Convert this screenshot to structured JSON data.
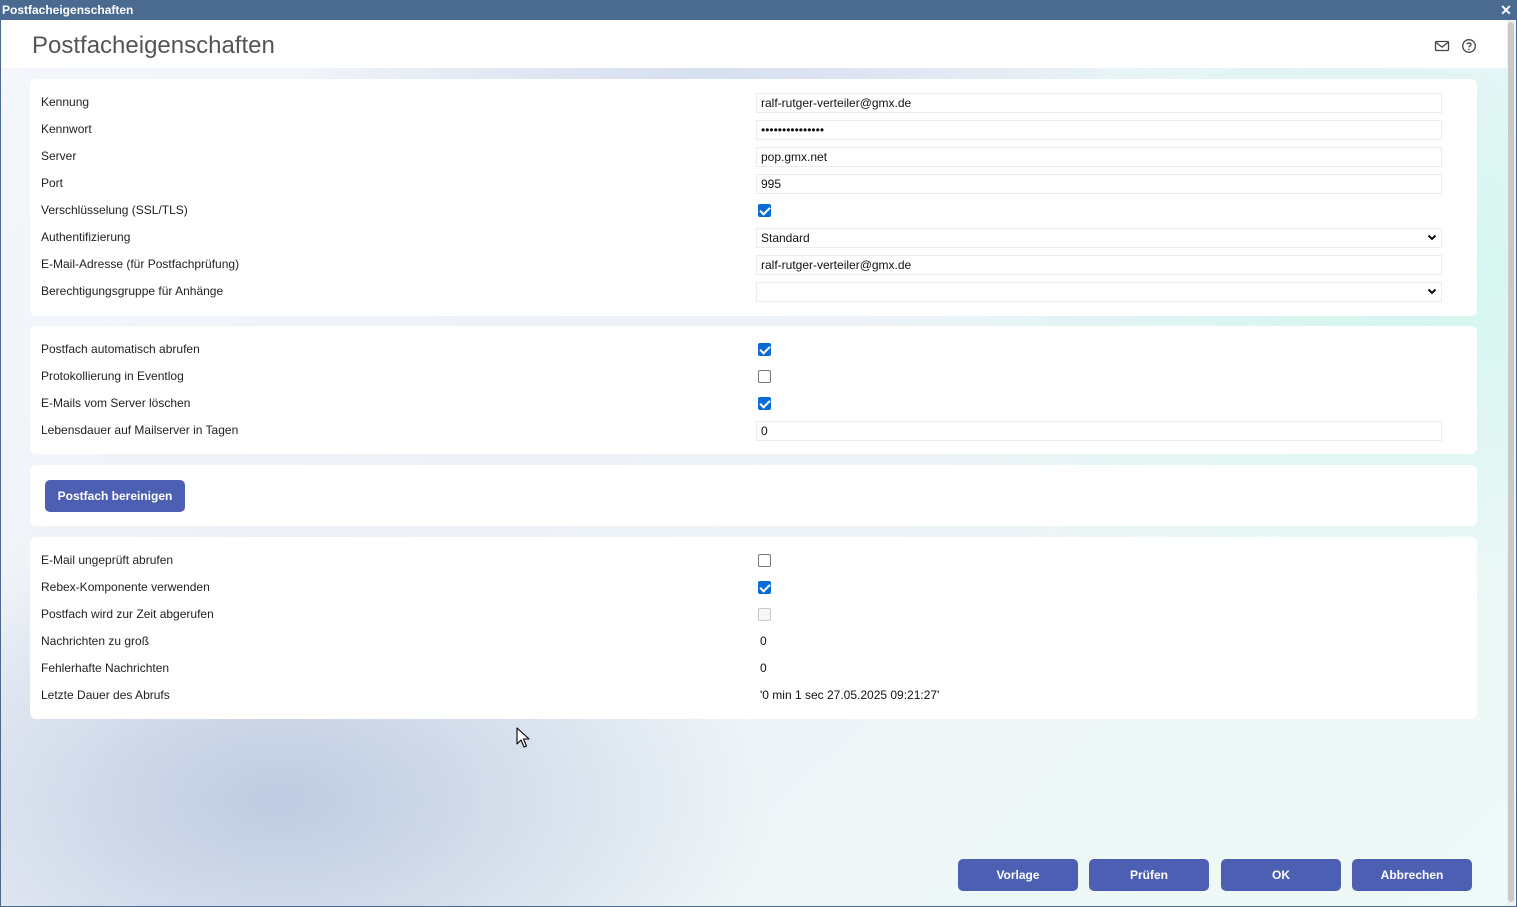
{
  "window": {
    "title": "Postfacheigenschaften",
    "close_glyph": "✕"
  },
  "header": {
    "title": "Postfacheigenschaften",
    "icons": [
      "mail-icon",
      "help-icon"
    ]
  },
  "connection": {
    "kennung_label": "Kennung",
    "kennung_value": "ralf-rutger-verteiler@gmx.de",
    "kennwort_label": "Kennwort",
    "kennwort_value": "•••••••••••••••",
    "server_label": "Server",
    "server_value": "pop.gmx.net",
    "port_label": "Port",
    "port_value": "995",
    "ssl_label": "Verschlüsselung (SSL/TLS)",
    "ssl_checked": true,
    "auth_label": "Authentifizierung",
    "auth_value": "Standard",
    "email_label": "E-Mail-Adresse (für Postfachprüfung)",
    "email_value": "ralf-rutger-verteiler@gmx.de",
    "group_label": "Berechtigungsgruppe für Anhänge",
    "group_value": ""
  },
  "retrieval": {
    "auto_label": "Postfach automatisch abrufen",
    "auto_checked": true,
    "log_label": "Protokollierung in Eventlog",
    "log_checked": false,
    "delete_label": "E-Mails vom Server löschen",
    "delete_checked": true,
    "lifetime_label": "Lebensdauer auf Mailserver in Tagen",
    "lifetime_value": "0"
  },
  "cleanup": {
    "button_label": "Postfach bereinigen"
  },
  "status": {
    "unchecked_label": "E-Mail ungeprüft abrufen",
    "unchecked_checked": false,
    "rebex_label": "Rebex-Komponente verwenden",
    "rebex_checked": true,
    "busy_label": "Postfach wird zur Zeit abgerufen",
    "busy_checked": false,
    "toolarge_label": "Nachrichten zu groß",
    "toolarge_value": "0",
    "faulty_label": "Fehlerhafte Nachrichten",
    "faulty_value": "0",
    "duration_label": "Letzte Dauer des Abrufs",
    "duration_value": "'0 min 1 sec 27.05.2025 09:21:27'"
  },
  "footer": {
    "template_label": "Vorlage",
    "check_label": "Prüfen",
    "ok_label": "OK",
    "cancel_label": "Abbrechen"
  },
  "colors": {
    "titlebar": "#4a6b8f",
    "button": "#4d5fb2",
    "checkbox": "#0b6bd4"
  }
}
